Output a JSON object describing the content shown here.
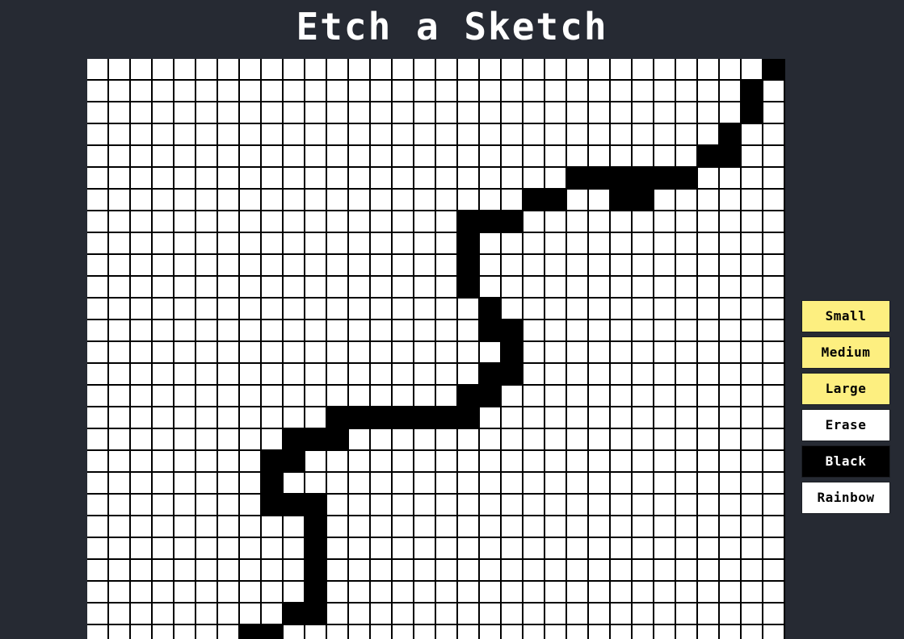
{
  "title": "Etch a Sketch",
  "grid": {
    "columns": 32,
    "visible_rows": 27,
    "cell_color": "#ffffff",
    "fill_color": "#000000",
    "filled_cells": [
      [
        0,
        31
      ],
      [
        1,
        30
      ],
      [
        2,
        30
      ],
      [
        3,
        29
      ],
      [
        4,
        28
      ],
      [
        4,
        29
      ],
      [
        5,
        22
      ],
      [
        5,
        23
      ],
      [
        5,
        24
      ],
      [
        5,
        25
      ],
      [
        5,
        26
      ],
      [
        5,
        27
      ],
      [
        6,
        20
      ],
      [
        6,
        21
      ],
      [
        6,
        24
      ],
      [
        6,
        25
      ],
      [
        7,
        17
      ],
      [
        7,
        18
      ],
      [
        7,
        19
      ],
      [
        8,
        17
      ],
      [
        9,
        17
      ],
      [
        10,
        17
      ],
      [
        11,
        18
      ],
      [
        12,
        18
      ],
      [
        12,
        19
      ],
      [
        13,
        19
      ],
      [
        14,
        18
      ],
      [
        14,
        19
      ],
      [
        15,
        17
      ],
      [
        15,
        18
      ],
      [
        16,
        11
      ],
      [
        16,
        12
      ],
      [
        16,
        13
      ],
      [
        16,
        14
      ],
      [
        16,
        15
      ],
      [
        16,
        16
      ],
      [
        16,
        17
      ],
      [
        17,
        9
      ],
      [
        17,
        10
      ],
      [
        17,
        11
      ],
      [
        18,
        8
      ],
      [
        18,
        9
      ],
      [
        19,
        8
      ],
      [
        20,
        8
      ],
      [
        20,
        9
      ],
      [
        20,
        10
      ],
      [
        21,
        10
      ],
      [
        22,
        10
      ],
      [
        23,
        10
      ],
      [
        24,
        10
      ],
      [
        25,
        9
      ],
      [
        25,
        10
      ],
      [
        26,
        7
      ],
      [
        26,
        8
      ]
    ]
  },
  "controls": [
    {
      "label": "Small",
      "bg": "#fdef80",
      "color": "#000000"
    },
    {
      "label": "Medium",
      "bg": "#fdef80",
      "color": "#000000"
    },
    {
      "label": "Large",
      "bg": "#fdef80",
      "color": "#000000"
    },
    {
      "label": "Erase",
      "bg": "#ffffff",
      "color": "#000000"
    },
    {
      "label": "Black",
      "bg": "#000000",
      "color": "#ffffff"
    },
    {
      "label": "Rainbow",
      "bg": "#ffffff",
      "color": "#000000"
    }
  ]
}
